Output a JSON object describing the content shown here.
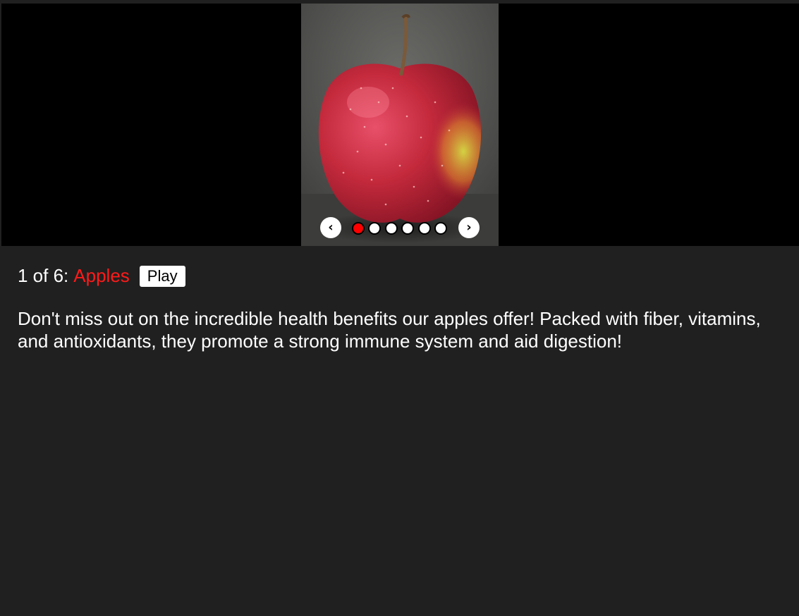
{
  "carousel": {
    "image_subject": "red apple",
    "prev_label": "‹",
    "next_label": "›",
    "current_index": 1,
    "total_slides": 6,
    "dots": [
      {
        "active": true
      },
      {
        "active": false
      },
      {
        "active": false
      },
      {
        "active": false
      },
      {
        "active": false
      },
      {
        "active": false
      }
    ]
  },
  "caption": {
    "counter": "1 of 6:",
    "title": "Apples",
    "play_label": "Play"
  },
  "description": "Don't miss out on the incredible health benefits our apples offer! Packed with fiber, vitamins, and antioxidants, they promote a strong immune system and aid digestion!",
  "colors": {
    "page_background": "#202020",
    "carousel_background": "#000000",
    "accent_red": "#ff0000",
    "text": "#ffffff"
  }
}
